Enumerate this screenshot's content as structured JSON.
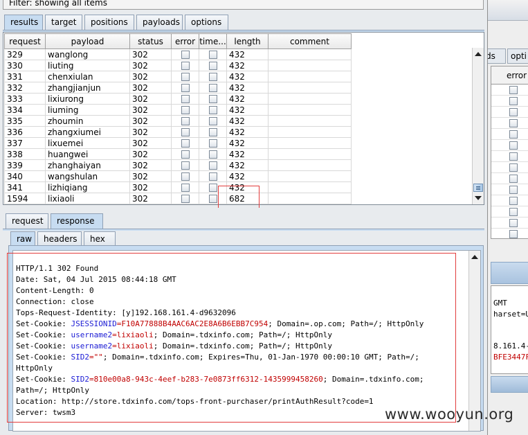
{
  "filter": {
    "text": "Filter: showing all items"
  },
  "result_tabs": [
    {
      "label": "results",
      "active": true
    },
    {
      "label": "target",
      "active": false
    },
    {
      "label": "positions",
      "active": false
    },
    {
      "label": "payloads",
      "active": false
    },
    {
      "label": "options",
      "active": false
    }
  ],
  "table": {
    "columns": [
      "request",
      "payload",
      "status",
      "error",
      "time...",
      "length",
      "comment"
    ],
    "rows": [
      {
        "request": "329",
        "payload": "wanglong",
        "status": "302",
        "error": false,
        "timeout": false,
        "length": "432",
        "comment": ""
      },
      {
        "request": "330",
        "payload": "liuting",
        "status": "302",
        "error": false,
        "timeout": false,
        "length": "432",
        "comment": ""
      },
      {
        "request": "331",
        "payload": "chenxiulan",
        "status": "302",
        "error": false,
        "timeout": false,
        "length": "432",
        "comment": ""
      },
      {
        "request": "332",
        "payload": "zhangjianjun",
        "status": "302",
        "error": false,
        "timeout": false,
        "length": "432",
        "comment": ""
      },
      {
        "request": "333",
        "payload": "lixiurong",
        "status": "302",
        "error": false,
        "timeout": false,
        "length": "432",
        "comment": ""
      },
      {
        "request": "334",
        "payload": "liuming",
        "status": "302",
        "error": false,
        "timeout": false,
        "length": "432",
        "comment": ""
      },
      {
        "request": "335",
        "payload": "zhoumin",
        "status": "302",
        "error": false,
        "timeout": false,
        "length": "432",
        "comment": ""
      },
      {
        "request": "336",
        "payload": "zhangxiumei",
        "status": "302",
        "error": false,
        "timeout": false,
        "length": "432",
        "comment": ""
      },
      {
        "request": "337",
        "payload": "lixuemei",
        "status": "302",
        "error": false,
        "timeout": false,
        "length": "432",
        "comment": ""
      },
      {
        "request": "338",
        "payload": "huangwei",
        "status": "302",
        "error": false,
        "timeout": false,
        "length": "432",
        "comment": ""
      },
      {
        "request": "339",
        "payload": "zhanghaiyan",
        "status": "302",
        "error": false,
        "timeout": false,
        "length": "432",
        "comment": ""
      },
      {
        "request": "340",
        "payload": "wangshulan",
        "status": "302",
        "error": false,
        "timeout": false,
        "length": "432",
        "comment": ""
      },
      {
        "request": "341",
        "payload": "lizhiqiang",
        "status": "302",
        "error": false,
        "timeout": false,
        "length": "432",
        "comment": ""
      },
      {
        "request": "1594",
        "payload": "lixiaoli",
        "status": "302",
        "error": false,
        "timeout": false,
        "length": "682",
        "comment": ""
      }
    ]
  },
  "detail_tabs": [
    {
      "label": "request",
      "active": false
    },
    {
      "label": "response",
      "active": true
    }
  ],
  "view_tabs": [
    {
      "label": "raw",
      "active": true
    },
    {
      "label": "headers",
      "active": false
    },
    {
      "label": "hex",
      "active": false
    }
  ],
  "response": {
    "status_line": "HTTP/1.1 302 Found",
    "date": "Date: Sat, 04 Jul 2015 08:44:18 GMT",
    "content_length": "Content-Length: 0",
    "connection": "Connection: close",
    "tops_request_identity": "Tops-Request-Identity: [y]192.168.161.4-d9632096",
    "cookie1": {
      "prefix": "Set-Cookie: ",
      "name": "JSESSIONID",
      "value": "=F10A77888B4AAC6AC2E8A6B6EBB7C954",
      "rest": "; Domain=.op.com; Path=/; HttpOnly"
    },
    "cookie2": {
      "prefix": "Set-Cookie: ",
      "name": "username2",
      "value": "=lixiaoli",
      "rest": "; Domain=.tdxinfo.com; Path=/; HttpOnly"
    },
    "cookie3": {
      "prefix": "Set-Cookie: ",
      "name": "username2",
      "value": "=lixiaoli",
      "rest": "; Domain=.tdxinfo.com; Path=/; HttpOnly"
    },
    "cookie4": {
      "prefix": "Set-Cookie: ",
      "name": "SID2",
      "value": "=\"\"",
      "rest": "; Domain=.tdxinfo.com; Expires=Thu, 01-Jan-1970 00:00:10 GMT; Path=/;",
      "cont": "HttpOnly"
    },
    "cookie5": {
      "prefix": "Set-Cookie: ",
      "name": "SID2",
      "value": "=810e00a8-943c-4eef-b283-7e0873ff6312-1435999458260",
      "rest": "; Domain=.tdxinfo.com;",
      "cont": "Path=/; HttpOnly"
    },
    "location": "Location: http://store.tdxinfo.com/tops-front-purchaser/printAuthResult?code=1",
    "server": "Server: twsm3"
  },
  "background_window": {
    "tab_fragment_1": "ds",
    "tab_fragment_2": "opti",
    "column_header": "error",
    "text_lines": [
      "GMT",
      "harset=U",
      "",
      "",
      "8.161.4-",
      "BFE3447F"
    ]
  },
  "watermark": "www.wooyun.org",
  "colors": {
    "tab_active": "#c7dcf1",
    "header_key": "#1a1ad4",
    "header_value": "#c00000",
    "highlight_box": "#e23b3b"
  }
}
